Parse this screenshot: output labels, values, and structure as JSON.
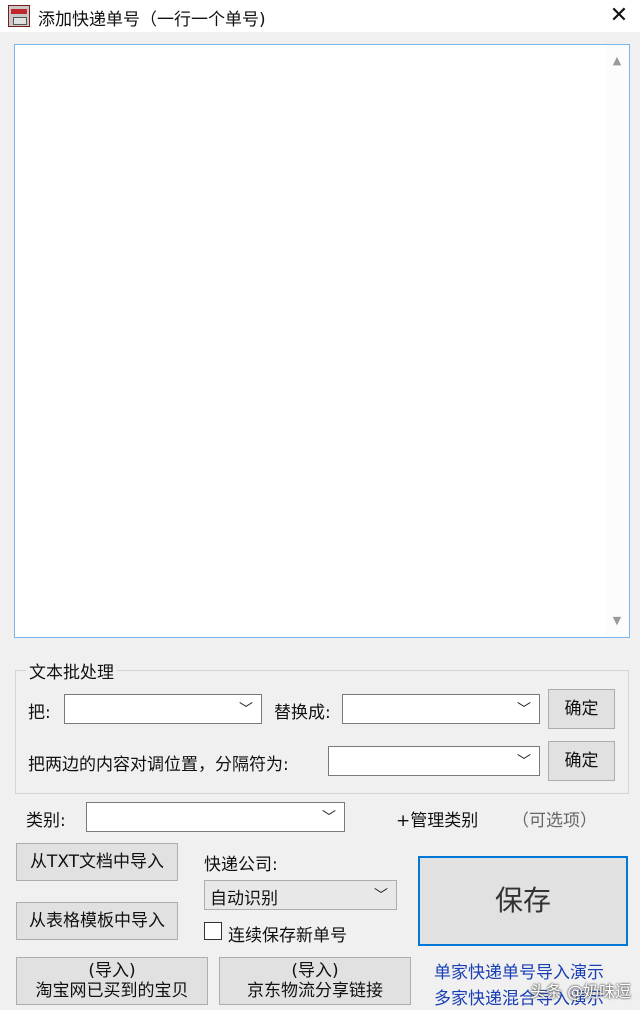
{
  "window": {
    "title": "添加快递单号（一行一个单号)",
    "close_glyph": "✕"
  },
  "textarea": {
    "value": "",
    "scroll_up": "▲",
    "scroll_down": "▼"
  },
  "batch": {
    "group_title": "文本批处理",
    "replace_label": "把:",
    "replace_from": "",
    "replace_with_label": "替换成:",
    "replace_to": "",
    "confirm1": "确定",
    "swap_label": "把两边的内容对调位置，分隔符为:",
    "swap_separator": "",
    "confirm2": "确定"
  },
  "category": {
    "label": "类别:",
    "value": "",
    "manage": "+管理类别",
    "optional": "（可选项）"
  },
  "import": {
    "txt": "从TXT文档中导入",
    "excel": "从表格模板中导入"
  },
  "courier": {
    "label": "快递公司:",
    "selected": "自动识别"
  },
  "continuous_save": {
    "label": "连续保存新单号",
    "checked": false
  },
  "save_button": "保存",
  "bottom_buttons": {
    "taobao_line1": "(导入)",
    "taobao_line2": "淘宝网已买到的宝贝",
    "jd_line1": "(导入)",
    "jd_line2": "京东物流分享链接"
  },
  "links": {
    "single_demo": "单家快递单号导入演示",
    "multi_demo": "多家快递混合导入演示"
  },
  "watermark": "头条 @奶味逗",
  "icons": {
    "dropdown": "chevron-down-icon",
    "close": "close-icon"
  },
  "colors": {
    "accent": "#0078d7",
    "link": "#1a3fb5",
    "textarea_border": "#7eb4ea"
  }
}
